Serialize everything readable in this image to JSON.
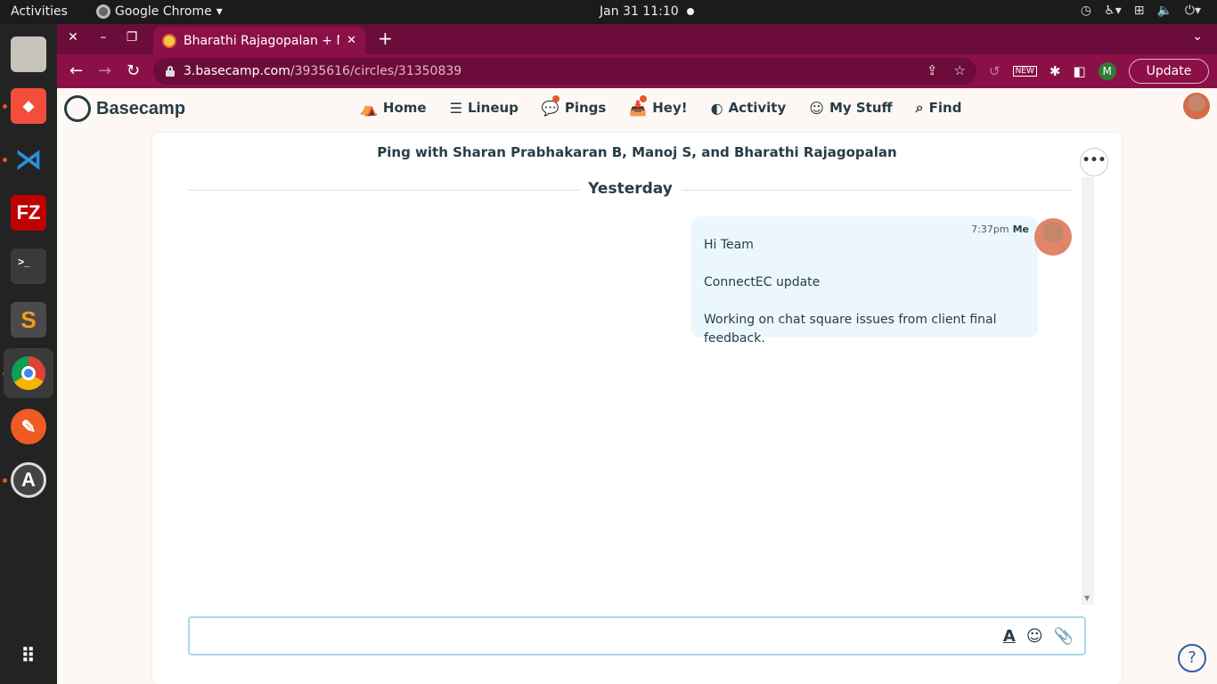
{
  "os": {
    "activities": "Activities",
    "app_menu": "Google Chrome",
    "clock": "Jan 31  11:10"
  },
  "browser": {
    "tab_title": "Bharathi Rajagopalan + M",
    "url_host": "3.basecamp.com",
    "url_path": "/3935616/circles/31350839",
    "update_label": "Update",
    "profile_initial": "M"
  },
  "basecamp": {
    "logo": "Basecamp",
    "nav": [
      {
        "label": "Home",
        "icon": "home-icon"
      },
      {
        "label": "Lineup",
        "icon": "lineup-icon"
      },
      {
        "label": "Pings",
        "icon": "pings-icon"
      },
      {
        "label": "Hey!",
        "icon": "hey-icon"
      },
      {
        "label": "Activity",
        "icon": "activity-icon"
      },
      {
        "label": "My Stuff",
        "icon": "smiley-icon"
      },
      {
        "label": "Find",
        "icon": "search-icon"
      }
    ]
  },
  "chat": {
    "title": "Ping with Sharan Prabhakaran B, Manoj S, and Bharathi Rajagopalan",
    "day_divider": "Yesterday",
    "message": {
      "time": "7:37pm",
      "author": "Me",
      "lines": [
        "Hi Team",
        "ConnectEC update",
        "Working on chat square issues from client final feedback."
      ]
    },
    "more_label": "•••",
    "composer_tools": {
      "format": "A",
      "emoji": "☺",
      "attach": "📎"
    }
  },
  "help_label": "?",
  "colors": {
    "tabstrip": "#6b0c3a",
    "toolbar": "#8c1048",
    "bubble": "#ecf7fd",
    "accent": "#e5582e"
  }
}
